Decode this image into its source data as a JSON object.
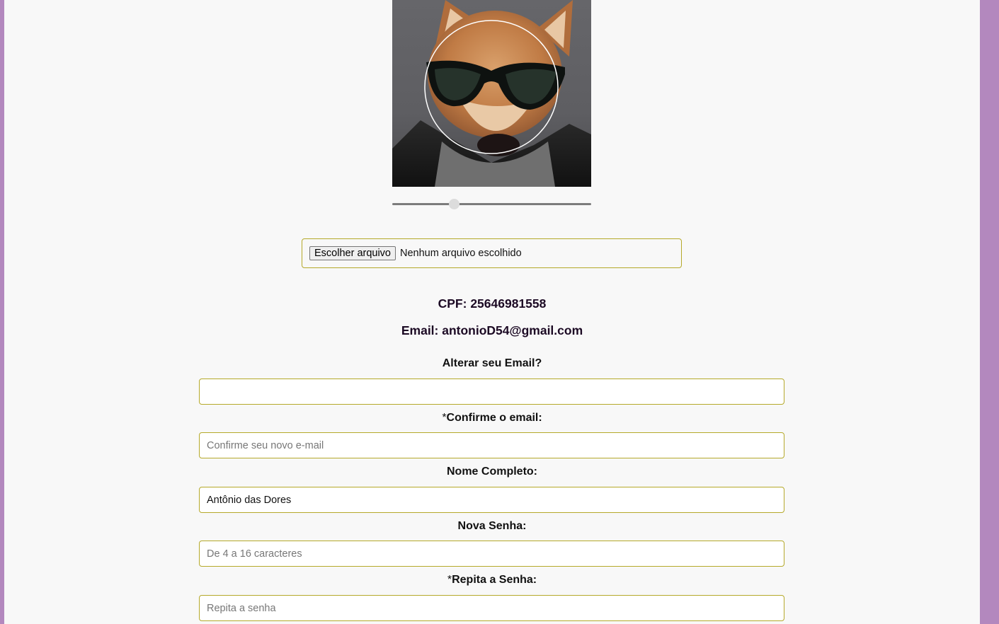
{
  "photo": {
    "alt": "Foto de perfil"
  },
  "zoom": {
    "value": 0.31
  },
  "file_input": {
    "button_label": "Escolher arquivo",
    "status": "Nenhum arquivo escolhido"
  },
  "profile": {
    "cpf": "CPF: 25646981558",
    "email": "Email: antonioD54@gmail.com"
  },
  "form": {
    "change_email_label": "Alterar seu Email?",
    "change_email_value": "",
    "confirm_email_required": "*",
    "confirm_email_label": "Confirme o email:",
    "confirm_email_placeholder": "Confirme seu novo e-mail",
    "full_name_label": "Nome Completo:",
    "full_name_value": "Antônio das Dores",
    "new_password_label": "Nova Senha:",
    "new_password_placeholder": "De 4 a 16 caracteres",
    "repeat_password_required": "*",
    "repeat_password_label": "Repita a Senha:",
    "repeat_password_placeholder": "Repita a senha"
  },
  "colors": {
    "side_border": "#b388be",
    "page_background": "#f8f8f8",
    "field_border": "#b5a92a",
    "info_text": "#1c0a24"
  }
}
